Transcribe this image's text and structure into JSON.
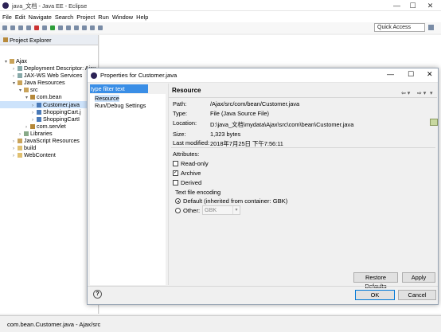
{
  "window": {
    "title": "java_文档 - Java EE - Eclipse"
  },
  "menu": [
    "File",
    "Edit",
    "Navigate",
    "Search",
    "Project",
    "Run",
    "Window",
    "Help"
  ],
  "toolbar": {
    "quick_access": "Quick Access"
  },
  "explorer": {
    "title": "Project Explorer",
    "items": [
      {
        "label": "Ajax"
      },
      {
        "label": "Deployment Descriptor: Ajax"
      },
      {
        "label": "JAX-WS Web Services"
      },
      {
        "label": "Java Resources"
      },
      {
        "label": "src"
      },
      {
        "label": "com.bean"
      },
      {
        "label": "Customer.java"
      },
      {
        "label": "ShoppingCart.j"
      },
      {
        "label": "ShoppingCartI"
      },
      {
        "label": "com.servlet"
      },
      {
        "label": "Libraries"
      },
      {
        "label": "JavaScript Resources"
      },
      {
        "label": "build"
      },
      {
        "label": "WebContent"
      }
    ]
  },
  "status": {
    "text": "com.bean.Customer.java - Ajax/src"
  },
  "dialog": {
    "title": "Properties for Customer.java",
    "filter_text": "type filter text",
    "nav": [
      "Resource",
      "Run/Debug Settings"
    ],
    "section_title": "Resource",
    "path_label": "Path:",
    "path_value": "/Ajax/src/com/bean/Customer.java",
    "type_label": "Type:",
    "type_value": "File  (Java Source File)",
    "location_label": "Location:",
    "location_value": "D:\\java_文档\\mydata\\Ajax\\src\\com\\bean\\Customer.java",
    "size_label": "Size:",
    "size_value": "1,323  bytes",
    "modified_label": "Last modified:",
    "modified_value": "2018年7月25日 下午7:56:11",
    "attributes_label": "Attributes:",
    "attr_readonly": "Read-only",
    "attr_archive": "Archive",
    "attr_derived": "Derived",
    "encoding_label": "Text file encoding",
    "enc_default": "Default (inherited from container: GBK)",
    "enc_other": "Other:",
    "enc_other_value": "GBK",
    "restore_defaults": "Restore Defaults",
    "apply": "Apply",
    "ok": "OK",
    "cancel": "Cancel",
    "help": "?"
  }
}
